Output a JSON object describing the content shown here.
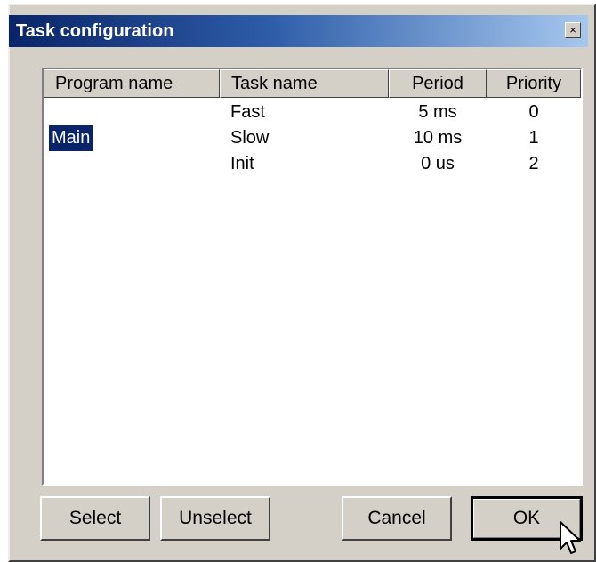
{
  "window": {
    "title": "Task configuration",
    "close_glyph": "×"
  },
  "table": {
    "columns": [
      "Program name",
      "Task name",
      "Period",
      "Priority"
    ],
    "program": "Main",
    "rows": [
      {
        "task": "Fast",
        "period": "5 ms",
        "priority": "0"
      },
      {
        "task": "Slow",
        "period": "10 ms",
        "priority": "1"
      },
      {
        "task": "Init",
        "period": "0 us",
        "priority": "2"
      }
    ]
  },
  "buttons": {
    "select": "Select",
    "unselect": "Unselect",
    "cancel": "Cancel",
    "ok": "OK"
  },
  "icons": {
    "close": "close-icon",
    "cursor": "mouse-pointer-icon"
  },
  "colors": {
    "title_gradient_start": "#0a2468",
    "title_gradient_end": "#a6c8ee",
    "selection_bg": "#0a246a",
    "dialog_bg": "#d4d0c8"
  }
}
